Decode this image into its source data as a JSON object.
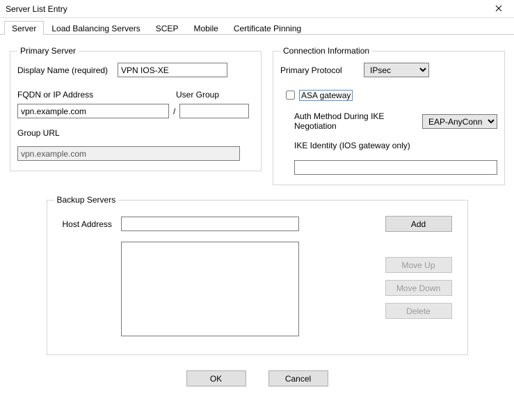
{
  "window": {
    "title": "Server List Entry"
  },
  "tabs": [
    {
      "label": "Server",
      "active": true
    },
    {
      "label": "Load Balancing Servers"
    },
    {
      "label": "SCEP"
    },
    {
      "label": "Mobile"
    },
    {
      "label": "Certificate Pinning"
    }
  ],
  "primaryServer": {
    "legend": "Primary Server",
    "displayNameLabel": "Display Name (required)",
    "displayNameValue": "VPN IOS-XE",
    "fqdnLabel": "FQDN or IP Address",
    "userGroupLabel": "User Group",
    "fqdnValue": "vpn.example.com",
    "userGroupValue": "",
    "slash": "/",
    "groupUrlLabel": "Group URL",
    "groupUrlValue": "vpn.example.com"
  },
  "connectionInfo": {
    "legend": "Connection Information",
    "primaryProtocolLabel": "Primary Protocol",
    "primaryProtocolValue": "IPsec",
    "asaGatewayLabel": "ASA gateway",
    "asaGatewayChecked": false,
    "authMethodLabel": "Auth Method During IKE Negotiation",
    "authMethodValue": "EAP-AnyConnect",
    "ikeIdentityLabel": "IKE Identity (IOS gateway only)",
    "ikeIdentityValue": ""
  },
  "backupServers": {
    "legend": "Backup Servers",
    "hostAddressLabel": "Host Address",
    "hostAddressValue": "",
    "addLabel": "Add",
    "moveUpLabel": "Move Up",
    "moveDownLabel": "Move Down",
    "deleteLabel": "Delete"
  },
  "buttons": {
    "ok": "OK",
    "cancel": "Cancel"
  }
}
